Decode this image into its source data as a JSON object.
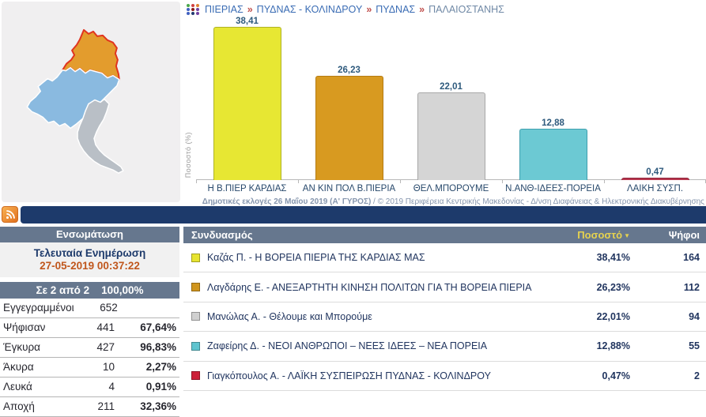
{
  "breadcrumb": {
    "separator": "»",
    "items": [
      "ΠΙΕΡΙΑΣ",
      "ΠΥΔΝΑΣ - ΚΟΛΙΝΔΡΟΥ",
      "ΠΥΔΝΑΣ",
      "ΠΑΛΑΙΟΣΤΑΝΗΣ"
    ]
  },
  "icons": {
    "dots_grid_colors": [
      "#4aa84a",
      "#d04040",
      "#e08030",
      "#4060c0",
      "#8b1a1a",
      "#7040a0",
      "#4060c0",
      "#203a70",
      "#7040a0"
    ],
    "rss": "rss-icon",
    "sort_arrow": "▼"
  },
  "map": {
    "background": "#f0eff0",
    "regions": [
      {
        "name": "selected-municipality",
        "fill": "#e39c2d",
        "stroke": "#e0341f"
      },
      {
        "name": "municipality-blue",
        "fill": "#8abae0",
        "stroke": "#ffffff"
      },
      {
        "name": "municipality-gray",
        "fill": "#b9bfc6",
        "stroke": "#ffffff"
      }
    ]
  },
  "chart_data": {
    "type": "bar",
    "title": "",
    "xlabel": "",
    "ylabel": "Ποσοστό (%)",
    "ylim": [
      0,
      40
    ],
    "grid": false,
    "legend": false,
    "value_label_position": "top",
    "categories": [
      "Η Β.ΠΙΕΡ ΚΑΡΔΙΑΣ",
      "ΑΝ ΚΙΝ ΠΟΛ Β.ΠΙΕΡΙΑ",
      "ΘΕΛ.ΜΠΟΡΟΥΜΕ",
      "Ν.ΑΝΘ-ΙΔΕΕΣ-ΠΟΡΕΙΑ",
      "ΛΑΪΚΗ ΣΥΣΠ."
    ],
    "values": [
      38.41,
      26.23,
      22.01,
      12.88,
      0.47
    ],
    "value_labels": [
      "38,41",
      "26,23",
      "22,01",
      "12,88",
      "0,47"
    ],
    "colors": [
      "#e7e733",
      "#d89a20",
      "#d5d5d5",
      "#6cc9d3",
      "#b8374e"
    ],
    "border_colors": [
      "#aeb225",
      "#b57b12",
      "#a8a8a8",
      "#3f9fae",
      "#8e2339"
    ]
  },
  "footer_note": {
    "bold": "Δημοτικές εκλογές 26 Μαΐου 2019 (Α' ΓΥΡΟΣ)",
    "rest": " / © 2019 Περιφέρεια Κεντρικής Μακεδονίας - Δ/νση Διαφάνειας & Ηλεκτρονικής Διακυβέρνησης"
  },
  "stats_panel": {
    "title": "Ενσωμάτωση",
    "last_update_label": "Τελευταία Ενημέρωση",
    "last_update_value": "27-05-2019 00:37:22",
    "progress": "Σε 2 από 2    100,00%",
    "rows": [
      {
        "label": "Εγγεγραμμένοι",
        "value": "652",
        "pct": ""
      },
      {
        "label": "Ψήφισαν",
        "value": "441",
        "pct": "67,64%"
      },
      {
        "label": "Έγκυρα",
        "value": "427",
        "pct": "96,83%"
      },
      {
        "label": "Άκυρα",
        "value": "10",
        "pct": "2,27%"
      },
      {
        "label": "Λευκά",
        "value": "4",
        "pct": "0,91%"
      },
      {
        "label": "Αποχή",
        "value": "211",
        "pct": "32,36%"
      }
    ]
  },
  "results_table": {
    "header": {
      "party": "Συνδυασμός",
      "pct": "Ποσοστό",
      "votes": "Ψήφοι"
    },
    "rows": [
      {
        "color": "#e7e430",
        "name": "Καζάς Π. - Η ΒΟΡΕΙΑ ΠΙΕΡΙΑ ΤΗΣ ΚΑΡΔΙΑΣ ΜΑΣ",
        "pct": "38,41%",
        "votes": "164"
      },
      {
        "color": "#d0951d",
        "name": "Λαγδάρης Ε. - ΑΝΕΞΑΡΤΗΤΗ ΚΙΝΗΣΗ ΠΟΛΙΤΩΝ ΓΙΑ ΤΗ ΒΟΡΕΙΑ ΠΙΕΡΙΑ",
        "pct": "26,23%",
        "votes": "112"
      },
      {
        "color": "#d0d0d0",
        "name": "Μανώλας Α. - Θέλουμε και Μπορούμε",
        "pct": "22,01%",
        "votes": "94"
      },
      {
        "color": "#5fc4cf",
        "name": "Ζαφείρης Δ. - ΝΕΟΙ ΑΝΘΡΩΠΟΙ – ΝΕΕΣ ΙΔΕΕΣ – ΝΕΑ ΠΟΡΕΙΑ",
        "pct": "12,88%",
        "votes": "55"
      },
      {
        "color": "#cc1f38",
        "name": "Γιαγκόπουλος Α. - ΛΑΪΚΗ ΣΥΣΠΕΙΡΩΣΗ ΠΥΔΝΑΣ - ΚΟΛΙΝΔΡΟΥ",
        "pct": "0,47%",
        "votes": "2"
      }
    ]
  }
}
